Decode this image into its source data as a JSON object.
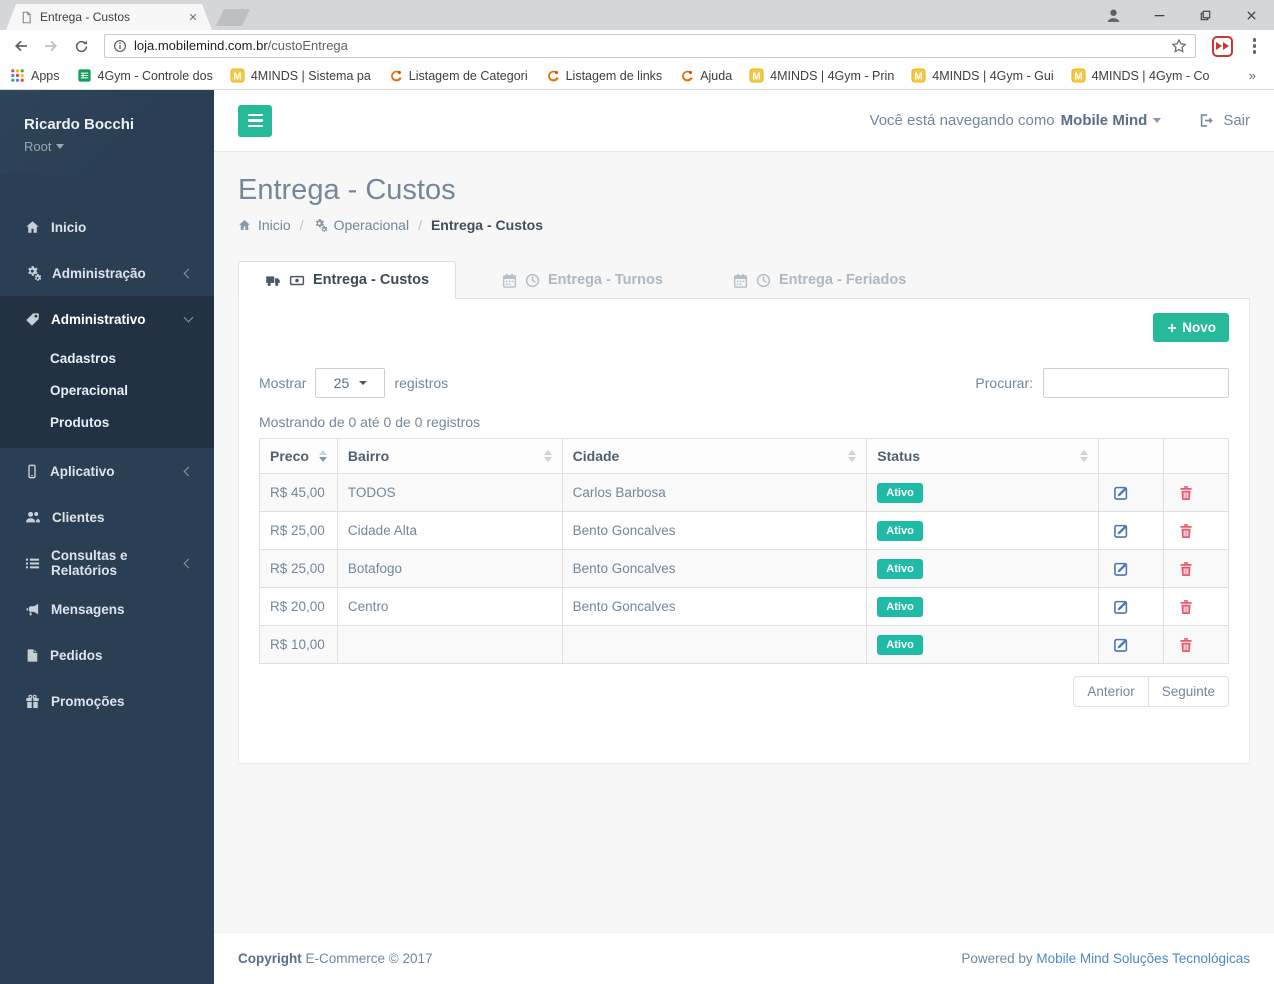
{
  "browser": {
    "tab_title": "Entrega - Custos",
    "url_host": "loja.mobilemind.com.br",
    "url_path": "/custoEntrega",
    "overflow_chevron": "»",
    "bookmarks": [
      {
        "label": "Apps",
        "icon": "apps-grid-icon"
      },
      {
        "label": "4Gym - Controle dos",
        "icon": "green-sheet-icon"
      },
      {
        "label": "4MINDS | Sistema pa",
        "icon": "yellow-m-icon"
      },
      {
        "label": "Listagem de Categori",
        "icon": "orange-swoosh-icon"
      },
      {
        "label": "Listagem de links",
        "icon": "orange-swoosh-icon"
      },
      {
        "label": "Ajuda",
        "icon": "orange-swoosh-icon"
      },
      {
        "label": "4MINDS | 4Gym - Prin",
        "icon": "yellow-m-icon"
      },
      {
        "label": "4MINDS | 4Gym - Gui",
        "icon": "yellow-m-icon"
      },
      {
        "label": "4MINDS | 4Gym - Co",
        "icon": "yellow-m-icon"
      }
    ]
  },
  "sidebar": {
    "profile_name": "Ricardo Bocchi",
    "profile_role": "Root",
    "items": [
      {
        "label": "Inicio",
        "icon": "home-icon"
      },
      {
        "label": "Administração",
        "icon": "gears-icon",
        "chevron": "left"
      },
      {
        "label": "Administrativo",
        "icon": "tag-icon",
        "chevron": "down",
        "active": true,
        "children": [
          {
            "label": "Cadastros"
          },
          {
            "label": "Operacional"
          },
          {
            "label": "Produtos"
          }
        ]
      },
      {
        "label": "Aplicativo",
        "icon": "mobile-icon",
        "chevron": "left"
      },
      {
        "label": "Clientes",
        "icon": "users-icon"
      },
      {
        "label": "Consultas e Relatórios",
        "icon": "list-icon",
        "chevron": "left"
      },
      {
        "label": "Mensagens",
        "icon": "bullhorn-icon"
      },
      {
        "label": "Pedidos",
        "icon": "file-icon"
      },
      {
        "label": "Promoções",
        "icon": "gift-icon"
      }
    ]
  },
  "topbar": {
    "navigating_as": "Você está navegando como",
    "user_name": "Mobile Mind",
    "logout_label": "Sair"
  },
  "page": {
    "title": "Entrega - Custos",
    "breadcrumb_separator": "/",
    "breadcrumb": [
      {
        "label": "Inicio",
        "icon": "home-icon"
      },
      {
        "label": "Operacional",
        "icon": "gears-icon"
      },
      {
        "label": "Entrega - Custos"
      }
    ]
  },
  "tabs": [
    {
      "label": "Entrega - Custos",
      "active": true,
      "icons": [
        "truck-icon",
        "cash-icon"
      ]
    },
    {
      "label": "Entrega - Turnos",
      "active": false,
      "icons": [
        "calendar-icon",
        "clock-icon"
      ]
    },
    {
      "label": "Entrega - Feriados",
      "active": false,
      "icons": [
        "calendar-icon",
        "clock-icon"
      ]
    }
  ],
  "panel": {
    "new_button_label": "Novo",
    "show_label": "Mostrar",
    "page_size": "25",
    "records_label": "registros",
    "search_label": "Procurar:",
    "search_value": "",
    "summary": "Mostrando de 0 até 0 de 0 registros",
    "pagination": {
      "prev_label": "Anterior",
      "next_label": "Seguinte"
    }
  },
  "table": {
    "columns": [
      {
        "label": "Preco",
        "sorted": "desc"
      },
      {
        "label": "Bairro"
      },
      {
        "label": "Cidade"
      },
      {
        "label": "Status"
      }
    ],
    "rows": [
      {
        "preco": "R$ 45,00",
        "bairro": "TODOS",
        "cidade": "Carlos Barbosa",
        "status": "Ativo"
      },
      {
        "preco": "R$ 25,00",
        "bairro": "Cidade Alta",
        "cidade": "Bento Goncalves",
        "status": "Ativo"
      },
      {
        "preco": "R$ 25,00",
        "bairro": "Botafogo",
        "cidade": "Bento Goncalves",
        "status": "Ativo"
      },
      {
        "preco": "R$ 20,00",
        "bairro": "Centro",
        "cidade": "Bento Goncalves",
        "status": "Ativo"
      },
      {
        "preco": "R$ 10,00",
        "bairro": "",
        "cidade": "",
        "status": "Ativo"
      }
    ]
  },
  "footer": {
    "copyright_label": "Copyright",
    "copyright_text": "E-Commerce © 2017",
    "powered_label": "Powered by",
    "powered_link_label": "Mobile Mind Soluções Tecnológicas"
  },
  "colors": {
    "accent_green": "#26B99A",
    "badge_green": "#1FBBA6",
    "sidebar_bg": "#2A3F54",
    "sidebar_active_bg": "#233242",
    "danger_red": "#E8596F",
    "edit_blue": "#4A77B4",
    "link_blue": "#4A89C7",
    "page_bg": "#F7F7F7"
  }
}
